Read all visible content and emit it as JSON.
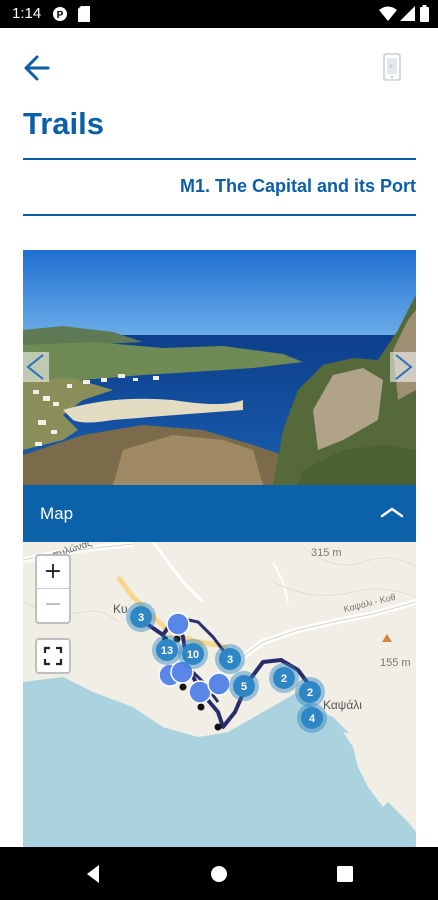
{
  "status_bar": {
    "time": "1:14",
    "icons": [
      "notification-p-icon",
      "sd-card-icon",
      "wifi-icon",
      "signal-icon",
      "battery-icon"
    ]
  },
  "header": {
    "back_icon": "arrow-left-icon",
    "device_icon": "phone-icon",
    "title": "Trails"
  },
  "trail": {
    "name": "M1. The Capital and its Port"
  },
  "gallery": {
    "prev_icon": "chevron-left-icon",
    "next_icon": "chevron-right-icon"
  },
  "map_section": {
    "label": "Map",
    "toggle_icon": "chevron-up-icon",
    "zoom_in": "+",
    "zoom_out": "−",
    "fullscreen_icon": "fullscreen-icon",
    "elevation_labels": [
      "315 m",
      "155 m"
    ],
    "road_labels": [
      "ας πυλώνας",
      "Καψάλι - Κυθ"
    ],
    "place_labels": [
      "Κυ",
      "Καψάλι"
    ],
    "cluster_counts": [
      "3",
      "13",
      "10",
      "3",
      "5",
      "2",
      "2",
      "4"
    ]
  },
  "colors": {
    "brand_blue": "#0b5ea8",
    "map_header_bg": "#0b62a8",
    "cluster_fill": "#2f86c4",
    "marker_fill": "#5a86e8",
    "route": "#2a2d6b",
    "sea": "#aad3df",
    "land": "#f1eee6"
  },
  "nav_bar": {
    "icons": [
      "back-triangle-icon",
      "home-circle-icon",
      "recents-square-icon"
    ]
  }
}
